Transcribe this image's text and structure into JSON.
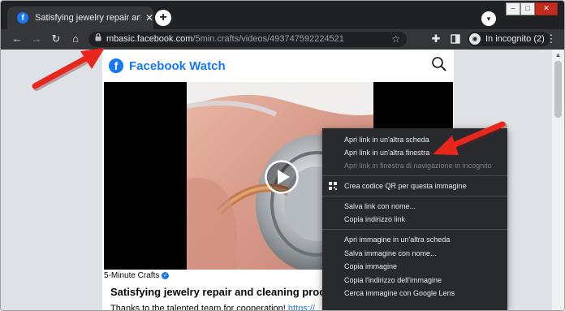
{
  "browser": {
    "tab_title": "Satisfying jewelry repair and clea",
    "tab_close": "✕",
    "new_tab": "+",
    "url_host": "mbasic.facebook.com",
    "url_path": "/5min.crafts/videos/493747592224521",
    "incognito_label": "In incognito (2)",
    "icons": [
      "facebook-tab-favicon",
      "back-arrow-icon",
      "forward-arrow-icon",
      "reload-icon",
      "home-icon",
      "lock-icon",
      "star-icon",
      "extensions-icon",
      "sidepanel-icon",
      "incognito-icon",
      "more-menu-icon"
    ]
  },
  "page": {
    "brand": "Facebook Watch",
    "channel": "5-Minute Crafts",
    "video_title": "Satisfying jewelry repair and cleaning processes",
    "description": "Thanks to the talented team for cooperation! ",
    "description_link": "https://"
  },
  "context_menu": {
    "items": [
      {
        "label": "Apri link in un'altra scheda",
        "enabled": true
      },
      {
        "label": "Apri link in un'altra finestra",
        "enabled": true
      },
      {
        "label": "Apri link in finestra di navigazione in incognito",
        "enabled": false
      },
      {
        "label": "Crea codice QR per questa immagine",
        "enabled": true,
        "icon": "qr-code-icon"
      },
      {
        "label": "Salva link con nome...",
        "enabled": true
      },
      {
        "label": "Copia indirizzo link",
        "enabled": true
      },
      {
        "label": "Apri immagine in un'altra scheda",
        "enabled": true
      },
      {
        "label": "Salva immagine con nome...",
        "enabled": true
      },
      {
        "label": "Copia immagine",
        "enabled": true
      },
      {
        "label": "Copia l'indirizzo dell'immagine",
        "enabled": true
      },
      {
        "label": "Cerca immagine con Google Lens",
        "enabled": true
      }
    ]
  },
  "colors": {
    "annotation_arrow": "#e8261c",
    "facebook_blue": "#1877f2",
    "chrome_dark": "#202124",
    "toolbar": "#35363a",
    "menu_bg": "#292a2d"
  }
}
